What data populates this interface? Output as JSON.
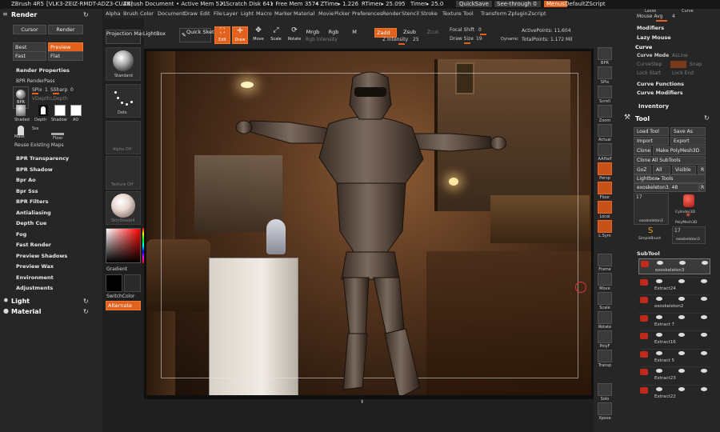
{
  "title_bar": {
    "app": "ZBrush 4R5",
    "license": "[VLK3-ZEIZ-RMDT-ADZ3-CUAK]",
    "doc": "ZBrush Document",
    "active_mem": "• Active Mem 521",
    "scratch": "• Scratch Disk 641",
    "free_mem": "• Free Mem 3574",
    "ztime": "• ZTime▸ 1.226",
    "rtimer": "RTimer▸ 25.095",
    "timer": "Timer▸ 25.0",
    "quicksave": "QuickSave",
    "see_through": "See-through",
    "see_through_val": "0",
    "menus": "Menus",
    "zscript": "DefaultZScript"
  },
  "menu": [
    "Alpha",
    "Brush",
    "Color",
    "Document",
    "Draw",
    "Edit",
    "File",
    "Layer",
    "Light",
    "Macro",
    "Marker",
    "Material",
    "Movie",
    "Picker",
    "Preferences",
    "Render",
    "Stencil",
    "Stroke",
    "Texture",
    "Tool",
    "Transform",
    "Zplugin",
    "Zscript"
  ],
  "left": {
    "render_title": "Render",
    "cursor": "Cursor",
    "render": "Render",
    "best": "Best",
    "preview": "Preview",
    "fast": "Fast",
    "flat": "Flat",
    "render_properties": "Render Properties",
    "bpr_renderpass": "BPR RenderPass",
    "spix_label": "SPix",
    "spix_val": "1",
    "ssharp_label": "SSharp",
    "ssharp_val": "0",
    "vdepth": "VDepth",
    "ldepth": "LDepth",
    "bpr_icon": "BPR",
    "passes": [
      "Shaded",
      "Depth",
      "Shadow",
      "AO"
    ],
    "mask": "Mask",
    "sss": "Sss",
    "floor": "Floor",
    "reuse": "Reuse Existing Maps",
    "items": [
      "BPR Transparency",
      "BPR Shadow",
      "Bpr Ao",
      "Bpr Sss",
      "BPR Filters",
      "Antialiasing",
      "Depth Cue",
      "Fog",
      "Fast Render",
      "Preview Shadows",
      "Preview Wax",
      "Environment",
      "Adjustments"
    ],
    "light": "Light",
    "material": "Material"
  },
  "tray": {
    "projection_master": "Projection Master",
    "lightbox": "LightBox",
    "standard": "Standard",
    "dots": "Dots",
    "alpha_off": "Alpha Off",
    "texture_off": "Texture Off",
    "material": "SkinShade4",
    "gradient": "Gradient",
    "switchcolor": "SwitchColor",
    "alternate": "Alternate"
  },
  "toolbar": {
    "quick_sketch": "Quick Sketch",
    "edit": "Edit",
    "draw": "Draw",
    "move": "Move",
    "scale": "Scale",
    "rotate": "Rotate",
    "mrgb": "Mrgb",
    "rgb": "Rgb",
    "m": "M",
    "rgb_intensity": "Rgb Intensity",
    "zadd": "Zadd",
    "zsub": "Zsub",
    "zcut": "Zcut",
    "z_intensity_label": "Z Intensity",
    "z_intensity_val": "25",
    "focal_shift_label": "Focal Shift",
    "focal_shift_val": "0",
    "draw_size_label": "Draw Size",
    "draw_size_val": "19",
    "dynamic": "Dynamic",
    "active_points": "ActivePoints: 11,604",
    "total_points": "TotalPoints: 1.172 Mil"
  },
  "shelf": [
    "BPR",
    "SPix",
    "Scroll",
    "Zoom",
    "Actual",
    "AAHalf",
    "Persp",
    "Floor",
    "Local",
    "L.Sym",
    "",
    "Frame",
    "Move",
    "Scale",
    "Rotate",
    "PolyF",
    "Transp",
    "",
    "Solo",
    "Xpose"
  ],
  "right": {
    "lasso": "Lasso",
    "curve": "Curve",
    "mouse_avg": "Mouse Avg",
    "mouse_avg_val": "4",
    "modifiers": "Modifiers",
    "lazy_mouse": "Lazy Mouse",
    "curve_hdr": "Curve",
    "curve_mode": "Curve Mode",
    "as_line": "AsLine",
    "curve_step": "CurveStep",
    "snap": "Snap",
    "lock_start": "Lock Start",
    "lock_end": "Lock End",
    "curve_functions": "Curve Functions",
    "curve_modifiers": "Curve Modifiers",
    "inventory": "Inventory",
    "tool_title": "Tool",
    "load_tool": "Load Tool",
    "save_as": "Save As",
    "import": "Import",
    "export": "Export",
    "clone": "Clone",
    "make_polymesh": "Make PolyMesh3D",
    "clone_all": "Clone All SubTools",
    "goz": "GoZ",
    "all": "All",
    "visible": "Visible",
    "r": "R",
    "lightbox_tools": "Lightbox▸ Tools",
    "tool_name": "exoskeleton3.",
    "tool_count": "48",
    "thumb_count": "17",
    "thumbs": [
      "exoskeleton3",
      "Cylinder3D",
      "PolyMesh3D",
      "SimpleBrush",
      "exoskeleton3"
    ],
    "subtool": "SubTool",
    "subtools": [
      "exoskeleton3",
      "Extract24",
      "exoskeleton2",
      "Extract 7",
      "Extract16",
      "Extract 5",
      "Extract23",
      "Extract22"
    ]
  },
  "colors": {
    "accent": "#e2611c",
    "panel": "#262626",
    "bg": "#1f1f1f"
  }
}
